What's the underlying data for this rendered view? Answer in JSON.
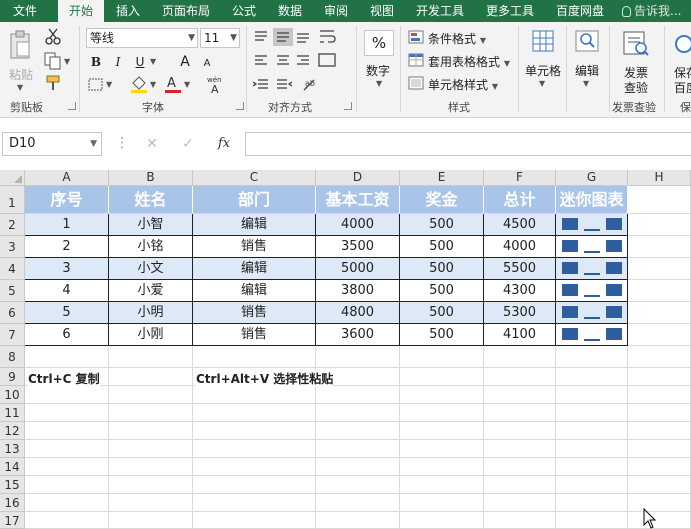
{
  "ribbon_tabs": [
    "文件",
    "开始",
    "插入",
    "页面布局",
    "公式",
    "数据",
    "审阅",
    "视图",
    "开发工具",
    "更多工具",
    "百度网盘"
  ],
  "tell_me": "告诉我...",
  "ribbon": {
    "clipboard": {
      "paste": "粘贴",
      "label": "剪贴板"
    },
    "font": {
      "name": "等线",
      "size": "11",
      "bold": "B",
      "italic": "I",
      "underline": "U",
      "grow": "A",
      "shrink": "A",
      "label": "字体"
    },
    "alignment": {
      "label": "对齐方式"
    },
    "number": {
      "percent": "%",
      "label": "数字"
    },
    "styles": {
      "conditional": "条件格式",
      "table_format": "套用表格格式",
      "cell_styles": "单元格样式",
      "label": "样式"
    },
    "cells": {
      "label": "单元格"
    },
    "editing": {
      "label": "编辑"
    },
    "invoice": {
      "line1": "发票",
      "line2": "查验",
      "label": "发票查验"
    },
    "save": {
      "line1": "保存",
      "line2": "百度",
      "label": "保"
    }
  },
  "formula_bar": {
    "name_box": "D10",
    "cancel": "✕",
    "enter": "✓",
    "fx": "fx",
    "value": ""
  },
  "columns": [
    "A",
    "B",
    "C",
    "D",
    "E",
    "F",
    "G",
    "H"
  ],
  "rows": [
    "1",
    "2",
    "3",
    "4",
    "5",
    "6",
    "7",
    "8",
    "9",
    "10",
    "11",
    "12",
    "13",
    "14",
    "15",
    "16",
    "17"
  ],
  "table": {
    "headers": [
      "序号",
      "姓名",
      "部门",
      "基本工资",
      "奖金",
      "总计",
      "迷你图表"
    ],
    "rows": [
      [
        "1",
        "小智",
        "编辑",
        "4000",
        "500",
        "4500"
      ],
      [
        "2",
        "小铭",
        "销售",
        "3500",
        "500",
        "4000"
      ],
      [
        "3",
        "小文",
        "编辑",
        "5000",
        "500",
        "5500"
      ],
      [
        "4",
        "小爱",
        "编辑",
        "3800",
        "500",
        "4300"
      ],
      [
        "5",
        "小明",
        "销售",
        "4800",
        "500",
        "5300"
      ],
      [
        "6",
        "小刚",
        "销售",
        "3600",
        "500",
        "4100"
      ]
    ]
  },
  "notes": {
    "a9": "Ctrl+C 复制",
    "c9": "Ctrl+Alt+V 选择性粘贴"
  },
  "selected_cell": "D10",
  "colors": {
    "ribbon_green": "#217346",
    "header_fill": "#a9c4e9",
    "band_fill": "#dde9f6",
    "sparkline": "#2e5e9e"
  }
}
